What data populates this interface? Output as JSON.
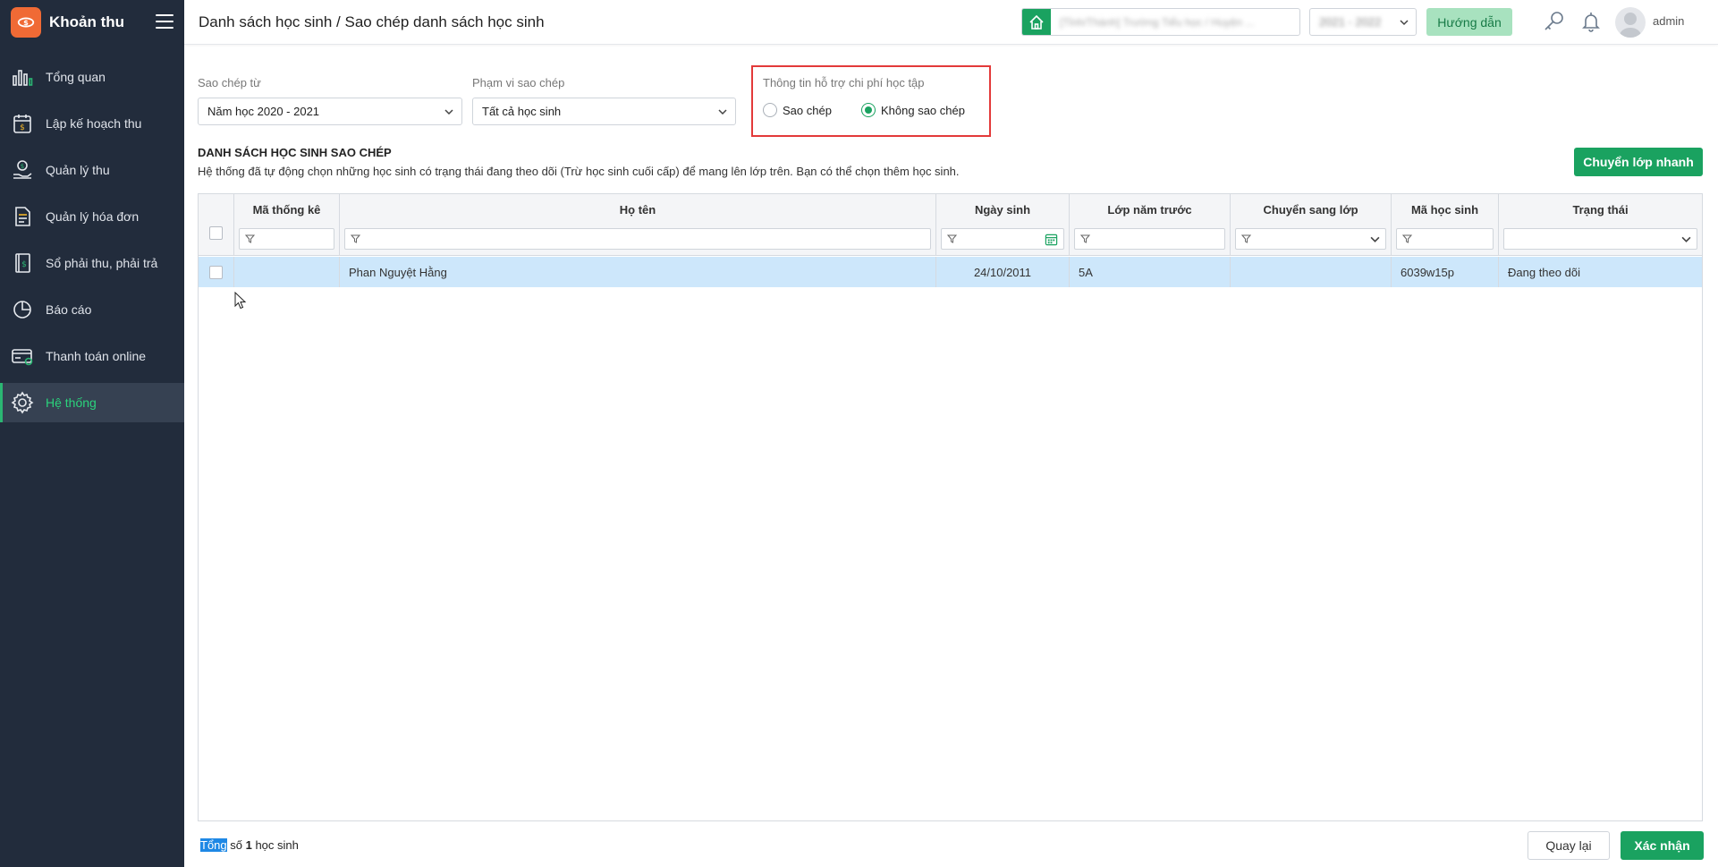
{
  "app": {
    "name": "Khoản thu"
  },
  "sidebar": {
    "items": [
      {
        "label": "Tổng quan",
        "icon": "bar-chart-icon"
      },
      {
        "label": "Lập kế hoạch thu",
        "icon": "plan-icon"
      },
      {
        "label": "Quản lý thu",
        "icon": "money-hand-icon"
      },
      {
        "label": "Quản lý hóa đơn",
        "icon": "invoice-icon"
      },
      {
        "label": "Sổ phải thu, phải trả",
        "icon": "ledger-icon"
      },
      {
        "label": "Báo cáo",
        "icon": "pie-chart-icon"
      },
      {
        "label": "Thanh toán online",
        "icon": "card-icon"
      },
      {
        "label": "Hệ thống",
        "icon": "gear-icon",
        "active": true
      }
    ]
  },
  "header": {
    "title": "Danh sách học sinh / Sao chép danh sách học sinh",
    "school_name": "[Tỉnh/Thành] Trường Tiểu học / Huyện ...",
    "year_value": "2021 - 2022",
    "help_label": "Hướng dẫn",
    "user_name": "admin"
  },
  "form": {
    "copy_from_label": "Sao chép từ",
    "copy_from_value": "Năm học 2020 - 2021",
    "scope_label": "Phạm vi sao chép",
    "scope_value": "Tất cả học sinh",
    "support_label": "Thông tin hỗ trợ chi phí học tập",
    "option_copy": "Sao chép",
    "option_no_copy": "Không sao chép",
    "selected_option": "no_copy"
  },
  "section": {
    "title": "DANH SÁCH HỌC SINH SAO CHÉP",
    "description": "Hệ thống đã tự động chọn những học sinh có trạng thái đang theo dõi (Trừ học sinh cuối cấp) để mang lên lớp trên. Bạn có thể chọn thêm học sinh.",
    "quick_move_label": "Chuyển lớp nhanh"
  },
  "table": {
    "columns": [
      "Mã thống kê",
      "Họ tên",
      "Ngày sinh",
      "Lớp năm trước",
      "Chuyển sang lớp",
      "Mã học sinh",
      "Trạng thái"
    ],
    "rows": [
      {
        "ma_thong_ke": "",
        "ho_ten": "Phan Nguyệt Hằng",
        "ngay_sinh": "24/10/2011",
        "lop_nam_truoc": "5A",
        "chuyen_sang_lop": "",
        "ma_hoc_sinh": "6039w15p",
        "trang_thai": "Đang theo dõi"
      }
    ]
  },
  "footer": {
    "total_prefix_highlight": "Tổng",
    "total_prefix_rest": " số ",
    "total_count": "1",
    "total_suffix": " học sinh",
    "back_label": "Quay lại",
    "confirm_label": "Xác nhận"
  },
  "colors": {
    "sidebar_bg": "#222c3c",
    "accent_green": "#1aa260",
    "highlight_red": "#e33a3a",
    "row_selected": "#cde7fb"
  }
}
